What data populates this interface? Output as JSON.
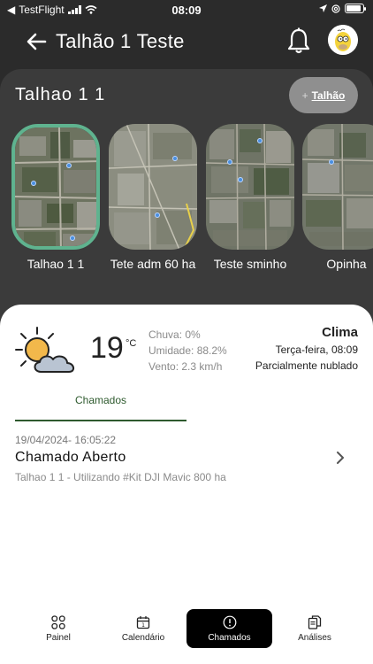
{
  "status_bar": {
    "carrier": "TestFlight",
    "time": "08:09"
  },
  "header": {
    "title": "Talhão 1 Teste"
  },
  "field_panel": {
    "title": "Talhao 1 1",
    "add_button": {
      "plus": "+",
      "label": "Talhão"
    },
    "thumbnails": [
      {
        "label": "Talhao 1 1",
        "selected": true
      },
      {
        "label": "Tete adm 60 ha",
        "selected": false
      },
      {
        "label": "Teste sminho",
        "selected": false
      },
      {
        "label": "Opinha",
        "selected": false
      }
    ]
  },
  "weather": {
    "temperature": "19",
    "unit": "°C",
    "rain": "Chuva: 0%",
    "humidity": "Umidade: 88.2%",
    "wind": "Vento: 2.3 km/h",
    "title": "Clima",
    "day_time": "Terça-feira, 08:09",
    "condition": "Parcialmente nublado",
    "icon": "partly-cloudy-icon"
  },
  "tabs": {
    "active": "Chamados"
  },
  "ticket": {
    "date": "19/04/2024- 16:05:22",
    "title": "Chamado Aberto",
    "description": "Talhao 1 1 - Utilizando #Kit DJI Mavic 800 ha"
  },
  "bottom_nav": {
    "items": [
      {
        "label": "Painel",
        "icon": "grid-icon"
      },
      {
        "label": "Calendário",
        "icon": "calendar-icon"
      },
      {
        "label": "Chamados",
        "icon": "alert-icon",
        "active": true
      },
      {
        "label": "Análises",
        "icon": "documents-icon"
      }
    ]
  },
  "colors": {
    "background": "#2b2b2b",
    "panel": "#3b3b3b",
    "selected_border": "#5fb38f",
    "tab_green": "#2e5a2e"
  }
}
